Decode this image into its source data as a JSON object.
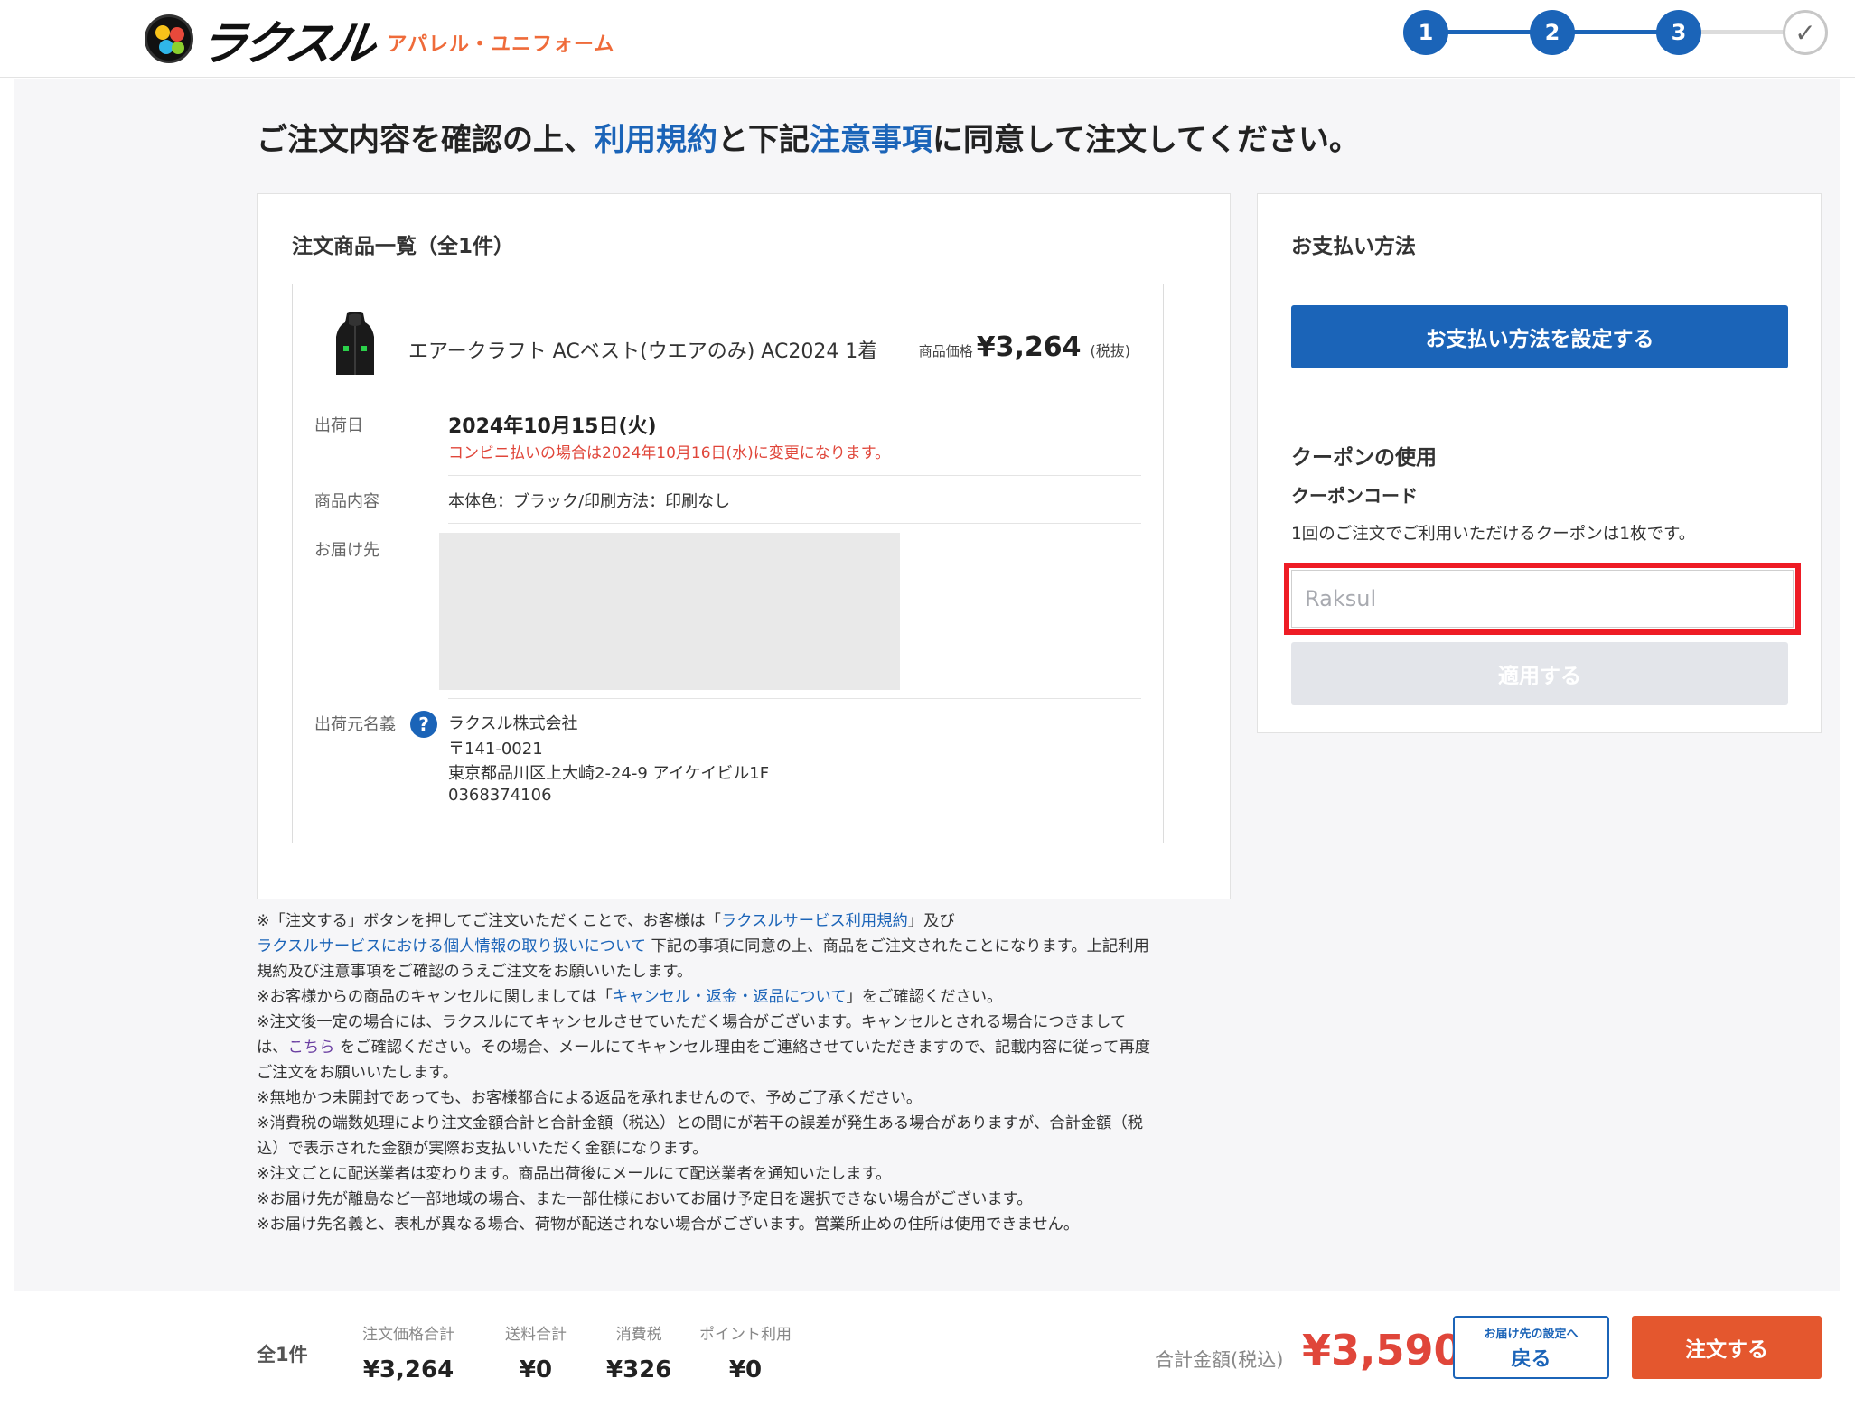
{
  "header": {
    "logo_text": "ラクスル",
    "logo_sub": "アパレル・ユニフォーム",
    "steps": [
      {
        "label": "1",
        "state": "active"
      },
      {
        "label": "2",
        "state": "active"
      },
      {
        "label": "3",
        "state": "active"
      },
      {
        "label": "✓",
        "state": "pending"
      }
    ]
  },
  "title": {
    "part1": "ご注文内容を確認の上、",
    "link1": "利用規約",
    "part2": "と下記",
    "link2": "注意事項",
    "part3": "に同意して注文してください。"
  },
  "order": {
    "heading": "注文商品一覧（全1件）",
    "product_name": "エアークラフト ACベスト(ウエアのみ) AC2024 1着",
    "price_label": "商品価格",
    "price": "¥3,264",
    "price_tax": "(税抜)",
    "ship_label": "出荷日",
    "ship_date": "2024年10月15日(火)",
    "ship_note": "コンビニ払いの場合は2024年10月16日(水)に変更になります。",
    "content_label": "商品内容",
    "content_value": "本体色：ブラック/印刷方法：印刷なし",
    "dest_label": "お届け先",
    "sender_label": "出荷元名義",
    "sender_help": "?",
    "sender_lines": [
      "ラクスル株式会社",
      "〒141-0021",
      "東京都品川区上大崎2-24-9 アイケイビル1F",
      "0368374106"
    ]
  },
  "notes": {
    "l1_a": "※「注文する」ボタンを押してご注文いただくことで、お客様は「",
    "l1_link": "ラクスルサービス利用規約",
    "l1_b": "」及び",
    "l2_link": "ラクスルサービスにおける個人情報の取り扱いについて",
    "l2_b": " 下記の事項に同意の上、商品をご注文されたことになります。上記利用",
    "l3": "規約及び注意事項をご確認のうえご注文をお願いいたします。",
    "l4_a": "※お客様からの商品のキャンセルに関しましては「",
    "l4_link": "キャンセル・返金・返品について",
    "l4_b": "」をご確認ください。",
    "l5": "※注文後一定の場合には、ラクスルにてキャンセルさせていただく場合がございます。キャンセルとされる場合につきまして",
    "l6_a": "は、",
    "l6_link": "こちら",
    "l6_b": " をご確認ください。その場合、メールにてキャンセル理由をご連絡させていただきますので、記載内容に従って再度",
    "l7": "ご注文をお願いいたします。",
    "l8": "※無地かつ未開封であっても、お客様都合による返品を承れませんので、予めご了承ください。",
    "l9": "※消費税の端数処理により注文金額合計と合計金額（税込）との間にが若干の誤差が発生ある場合がありますが、合計金額（税",
    "l10": "込）で表示された金額が実際お支払いいただく金額になります。",
    "l11": "※注文ごとに配送業者は変わります。商品出荷後にメールにて配送業者を通知いたします。",
    "l12": "※お届け先が離島など一部地域の場合、また一部仕様においてお届け予定日を選択できない場合がございます。",
    "l13": "※お届け先名義と、表札が異なる場合、荷物が配送されない場合がございます。営業所止めの住所は使用できません。"
  },
  "payment": {
    "heading": "お支払い方法",
    "set_button": "お支払い方法を設定する",
    "coupon_heading": "クーポンの使用",
    "coupon_code_label": "クーポンコード",
    "coupon_note": "1回のご注文でご利用いただけるクーポンは1枚です。",
    "coupon_placeholder": "Raksul",
    "apply_button": "適用する"
  },
  "footer": {
    "count": "全1件",
    "subtotal_label": "注文価格合計",
    "subtotal": "¥3,264",
    "shipping_label": "送料合計",
    "shipping": "¥0",
    "tax_label": "消費税",
    "tax": "¥326",
    "points_label": "ポイント利用",
    "points": "¥0",
    "total_label": "合計金額(税込)",
    "total": "¥3,590",
    "back_small": "お届け先の設定へ",
    "back_label": "戻る",
    "order_button": "注文する"
  },
  "colors": {
    "accent_blue": "#1b64b8",
    "order_orange": "#e4572e",
    "total_red": "#e0463a",
    "highlight_red": "#ee1c25"
  }
}
